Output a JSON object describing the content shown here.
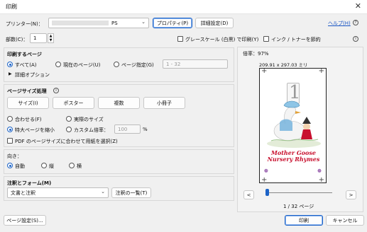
{
  "window": {
    "title": "印刷",
    "close_glyph": "✕"
  },
  "printer": {
    "label": "プリンター(N)：",
    "value": "PS",
    "properties_button": "プロパティ(P)",
    "advanced_button": "詳細設定(D)",
    "help_link": "ヘルプ(H)"
  },
  "copies": {
    "label": "部数(C)：",
    "value": "1"
  },
  "options": {
    "grayscale_label": "グレースケール (白黒) で印刷(Y)",
    "grayscale_checked": false,
    "ink_save_label": "インク / トナーを節約",
    "ink_save_checked": false
  },
  "pages_to_print": {
    "heading": "印刷するページ",
    "all_label": "すべて(A)",
    "current_label": "現在のページ(U)",
    "range_label": "ページ指定(G)",
    "range_placeholder": "1 - 32",
    "more_options": "詳細オプション"
  },
  "page_sizing": {
    "heading": "ページサイズ処理",
    "tabs": [
      "サイズ(I)",
      "ポスター",
      "複数",
      "小冊子"
    ],
    "fit_label": "合わせる(F)",
    "actual_label": "実際のサイズ",
    "shrink_label": "特大ページを縮小",
    "custom_label": "カスタム倍率：",
    "custom_value": "100",
    "percent": "%",
    "choose_paper_label": "PDF のページサイズに合わせて用紙を選択(Z)",
    "selected": "shrink"
  },
  "orientation": {
    "heading": "向き：",
    "auto_label": "自動",
    "portrait_label": "縦",
    "landscape_label": "横",
    "selected": "auto"
  },
  "comments": {
    "heading": "注釈とフォーム(M)",
    "value": "文書と注釈",
    "summary_button": "注釈の一覧(T)"
  },
  "preview": {
    "zoom_label": "倍率：97%",
    "dimensions": "209.91 x 297.03 ミリ",
    "big_number": "1",
    "book_title_line1": "Mother Goose",
    "book_title_line2": "Nursery Rhymes",
    "prev_button": "<",
    "next_button": ">",
    "page_indicator": "1 / 32 ページ",
    "page_position_fraction": 0.03
  },
  "footer": {
    "page_setup_button": "ページ設定(S)...",
    "print_button": "印刷",
    "cancel_button": "キャンセル"
  },
  "colors": {
    "accent": "#1c63c7",
    "title_red": "#c8102e",
    "title_purple": "#6b1a8a",
    "link": "#1a56c4"
  }
}
